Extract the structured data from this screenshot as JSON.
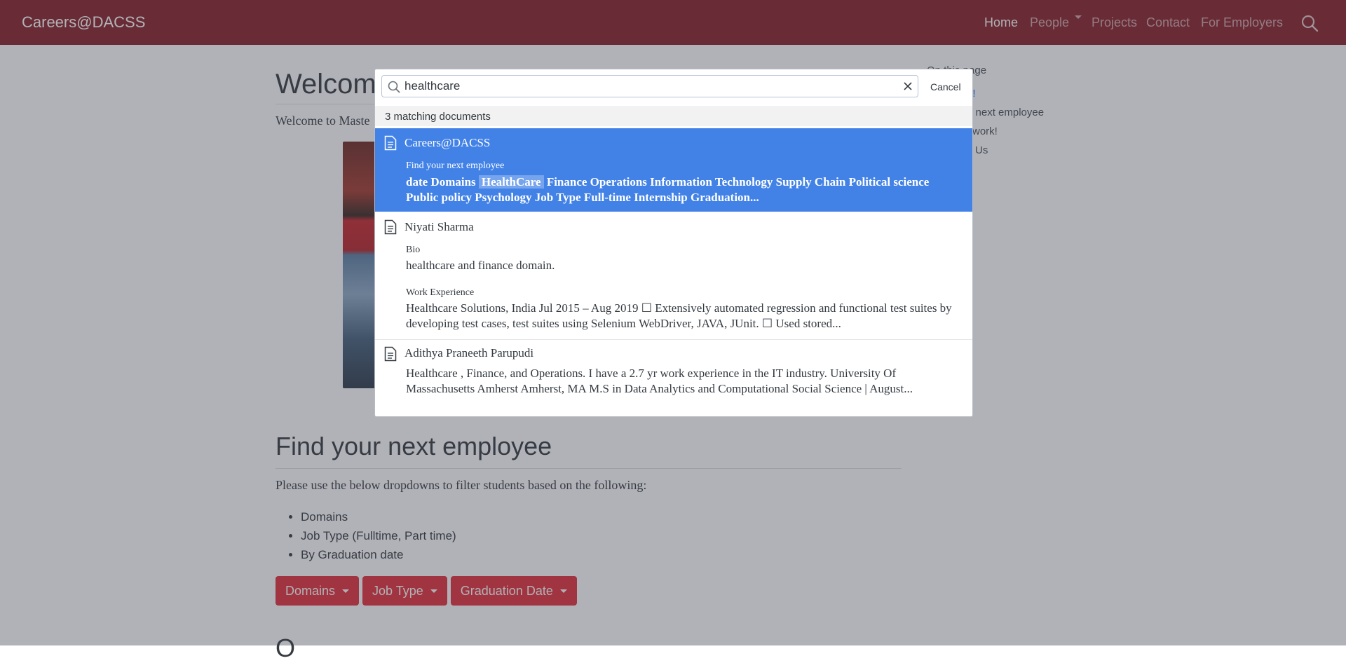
{
  "navbar": {
    "brand": "Careers@DACSS",
    "links": [
      {
        "label": "Home"
      },
      {
        "label": "People"
      },
      {
        "label": "Projects"
      },
      {
        "label": "Contact"
      },
      {
        "label": "For Employers"
      }
    ]
  },
  "page": {
    "title": "Welcome",
    "intro": "Welcome to Maste",
    "toc": {
      "title": "On this page",
      "title_visible": "On this page",
      "items": [
        "e!",
        "ur next employee",
        "work!",
        "Us"
      ]
    },
    "section_title": "Find your next employee",
    "filter_intro": "Please use the below dropdowns to filter students based on the following:",
    "bullets": [
      "Domains",
      "Job Type (Fulltime, Part time)",
      "By Graduation date"
    ],
    "buttons": [
      "Domains",
      "Job Type",
      "Graduation Date"
    ],
    "next_section_partial": "O"
  },
  "search": {
    "query": "healthcare",
    "cancel_label": "Cancel",
    "count_label": "3 matching documents",
    "results": [
      {
        "title": "Careers@DACSS",
        "section": "Find your next employee",
        "text_before": "date Domains ",
        "match": "HealthCare",
        "text_after": " Finance Operations Information Technology Supply Chain Political science Public policy Psychology Job Type Full-time Internship Graduation..."
      },
      {
        "title": "Niyati Sharma",
        "sections": [
          {
            "label": "Bio",
            "text": " healthcare  and finance domain."
          },
          {
            "label": "Work Experience",
            "text": " Healthcare  Solutions, India Jul 2015 – Aug 2019 ☐ Extensively automated regression and functional test suites by developing test cases, test suites using Selenium WebDriver, JAVA, JUnit. ☐ Used stored..."
          }
        ]
      },
      {
        "title": "Adithya Praneeth Parupudi",
        "text": " Healthcare , Finance, and Operations. I have a 2.7 yr work experience in the IT industry. University Of Massachusetts Amherst Amherst, MA M.S in Data Analytics and Computational Social Science | August..."
      }
    ]
  },
  "colors": {
    "navbar": "#881f27",
    "button": "#e32d3a",
    "selected_result": "#4282e6"
  },
  "icons": [
    "search-icon",
    "clear-icon",
    "document-icon"
  ]
}
